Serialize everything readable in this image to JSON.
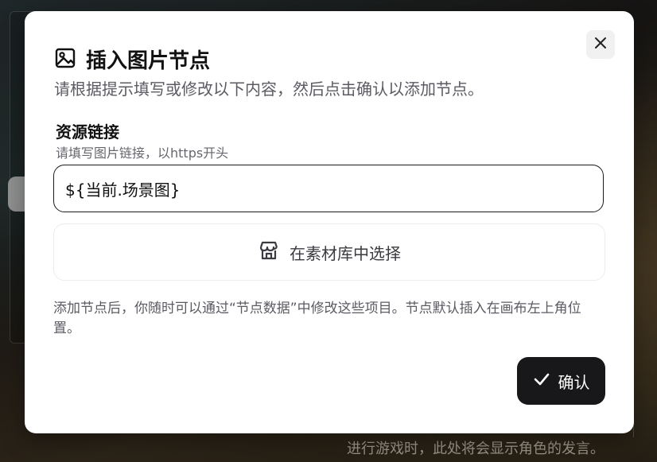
{
  "background": {
    "caption": "进行游戏时，此处将会显示角色的发言。"
  },
  "dialog": {
    "title": "插入图片节点",
    "title_icon": "image-icon",
    "description": "请根据提示填写或修改以下内容，然后点击确认以添加节点。",
    "close_icon": "close-icon",
    "field": {
      "label": "资源链接",
      "hint": "请填写图片链接，以https开头",
      "value": "${当前.场景图}"
    },
    "library_button": {
      "label": "在素材库中选择",
      "icon": "store-icon"
    },
    "note": "添加节点后，你随时可以通过“节点数据”中修改这些项目。节点默认插入在画布左上角位置。",
    "confirm_button": {
      "label": "确认",
      "icon": "check-icon"
    }
  },
  "colors": {
    "primary": "#18181b",
    "muted_text": "#5b5b63",
    "border": "#ececef"
  }
}
